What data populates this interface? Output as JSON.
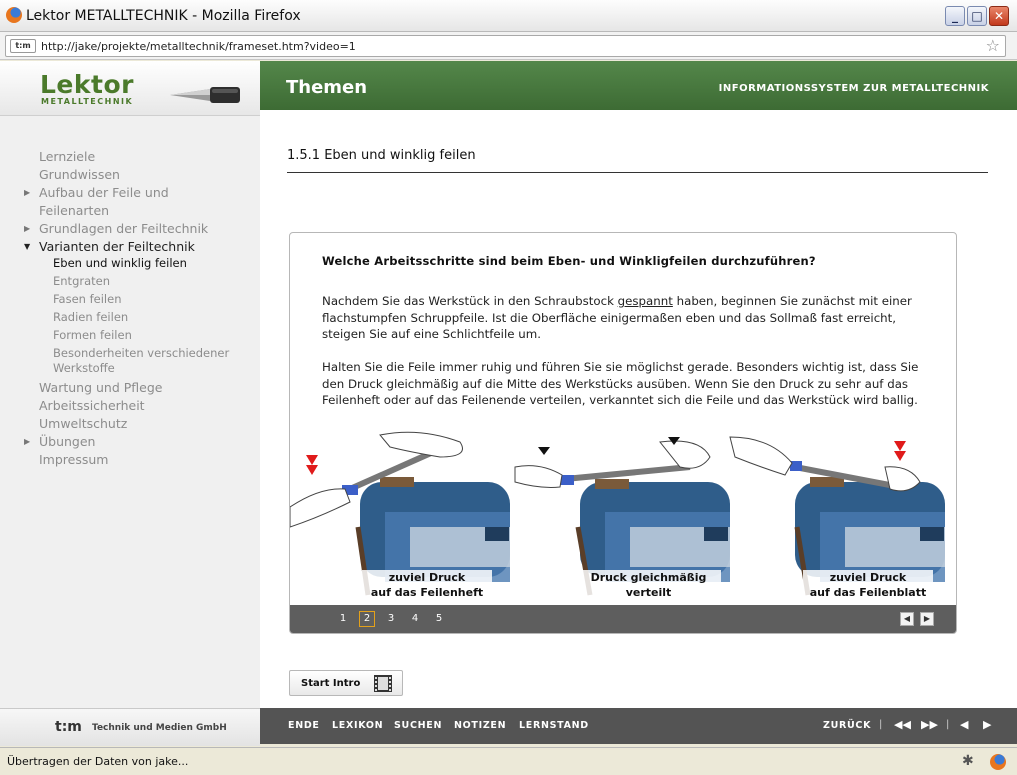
{
  "window": {
    "title": "Lektor METALLTECHNIK - Mozilla Firefox",
    "minimize_glyph": "_",
    "maximize_glyph": "□",
    "close_glyph": "✕"
  },
  "addressbar": {
    "site_icon_text": "t:m",
    "url": "http://jake/projekte/metalltechnik/frameset.htm?video=1"
  },
  "logo": {
    "main": "Lektor",
    "sub": "METALLTECHNIK"
  },
  "header": {
    "title": "Themen",
    "subtitle": "INFORMATIONSSYSTEM ZUR METALLTECHNIK"
  },
  "sidebar": {
    "items": [
      {
        "label": "Lernziele",
        "arrow": ""
      },
      {
        "label": "Grundwissen",
        "arrow": ""
      },
      {
        "label": "Aufbau der Feile und Feilenarten",
        "arrow": "right"
      },
      {
        "label": "Grundlagen der Feiltechnik",
        "arrow": "right"
      },
      {
        "label": "Varianten der Feiltechnik",
        "arrow": "down"
      },
      {
        "label": "Wartung und Pflege",
        "arrow": ""
      },
      {
        "label": "Arbeitssicherheit",
        "arrow": ""
      },
      {
        "label": "Umweltschutz",
        "arrow": ""
      },
      {
        "label": "Übungen",
        "arrow": "right"
      },
      {
        "label": "Impressum",
        "arrow": ""
      }
    ],
    "subitems": [
      {
        "label": "Eben und winklig feilen"
      },
      {
        "label": "Entgraten"
      },
      {
        "label": "Fasen feilen"
      },
      {
        "label": "Radien feilen"
      },
      {
        "label": "Formen feilen"
      },
      {
        "label": "Besonderheiten verschiedener Werkstoffe"
      }
    ]
  },
  "content": {
    "section_title": "1.5.1 Eben und winklig feilen",
    "question": "Welche Arbeitsschritte sind beim Eben- und Winkligfeilen durchzuführen?",
    "p1_before": "Nachdem Sie das Werkstück in den Schraubstock ",
    "p1_link": "gespannt",
    "p1_after": " haben, beginnen Sie zunächst mit einer flachstumpfen Schruppfeile. Ist die Oberfläche einigermaßen eben und das Sollmaß fast erreicht, steigen Sie auf eine Schlichtfeile um.",
    "p2": "Halten Sie die Feile immer ruhig und führen Sie sie möglichst gerade. Besonders wichtig ist, dass Sie den Druck gleichmäßig auf die Mitte des Werkstücks ausüben. Wenn Sie den Druck zu sehr auf das Feilenheft oder auf das Feilenende verteilen, verkanntet sich die Feile und das Werkstück wird ballig.",
    "captions": [
      {
        "line1": "zuviel Druck",
        "line2": "auf das Feilenheft"
      },
      {
        "line1": "Druck gleichmäßig",
        "line2": "verteilt"
      },
      {
        "line1": "zuviel Druck",
        "line2": "auf das Feilenblatt"
      }
    ],
    "pages": [
      "1",
      "2",
      "3",
      "4",
      "5"
    ],
    "selected_page": "2",
    "prev_glyph": "◀",
    "next_glyph": "▶",
    "start_intro_label": "Start Intro"
  },
  "footer": {
    "logo": "t:m",
    "company": "Technik und Medien GmbH",
    "nav": [
      "ENDE",
      "LEXIKON",
      "SUCHEN",
      "NOTIZEN",
      "LERNSTAND"
    ],
    "back_label": "ZURÜCK",
    "sep": "|",
    "rewind_glyph": "◀◀",
    "forward_glyph": "▶▶",
    "prev_glyph": "◀",
    "next_glyph": "▶"
  },
  "status": {
    "text": "Übertragen der Daten von jake..."
  },
  "colors": {
    "brand_green": "#4b7a2b",
    "header_green": "#487a3e",
    "page_highlight": "#e3a11b",
    "vise_blue": "#2f5d8a"
  }
}
